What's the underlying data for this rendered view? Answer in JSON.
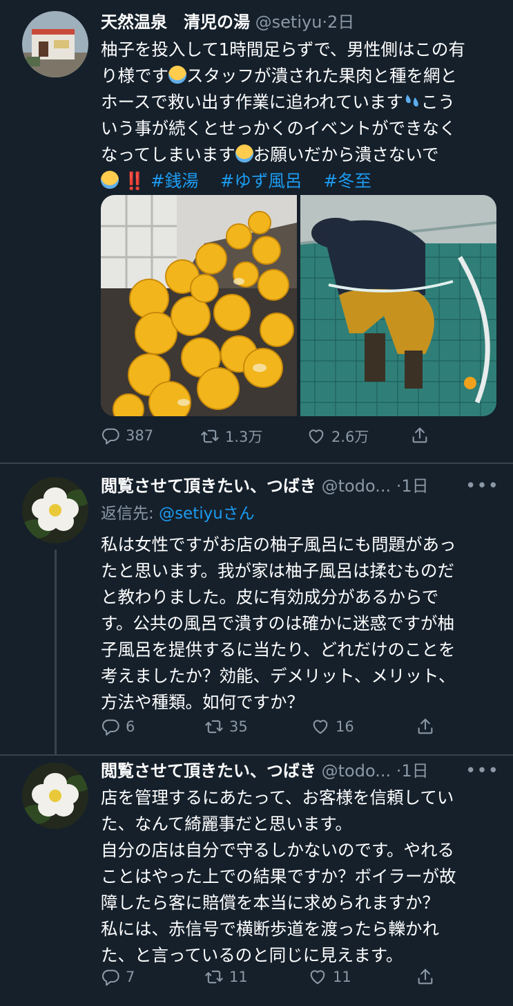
{
  "tweet1": {
    "name": "天然温泉　清児の湯",
    "handle": "@setiyu",
    "time": "·2日",
    "text_lines": [
      "柚子を投入して1時間足らずで、男性側はこの有",
      "り様です",
      "スタッフが潰された果肉と種を網と",
      "ホースで救い出す作業に追われています",
      "こう",
      "いう事が続くとせっかくのイベントができなく",
      "なってしまいます",
      "お願いだから潰さないで",
      "‼️"
    ],
    "hashtags": [
      "#銭湯",
      "#ゆず風呂",
      "#冬至"
    ],
    "replies": "387",
    "retweets": "1.3万",
    "likes": "2.6万"
  },
  "tweet2": {
    "name": "閲覧させて頂きたい、つばき",
    "handle": "@todo...",
    "time": "·1日",
    "more": "•••",
    "reply_prefix": "返信先: ",
    "reply_to": "@setiyuさん",
    "lines": [
      "私は女性ですがお店の柚子風呂にも問題があっ",
      "たと思います。我が家は柚子風呂は揉むものだ",
      "と教わりました。皮に有効成分があるからで",
      "す。公共の風呂で潰すのは確かに迷惑ですが柚",
      "子風呂を提供するに当たり、どれだけのことを",
      "考えましたか？効能、デメリット、メリット、",
      "方法や種類。如何ですか？"
    ],
    "replies": "6",
    "retweets": "35",
    "likes": "16"
  },
  "tweet3": {
    "name": "閲覧させて頂きたい、つばき",
    "handle": "@todo...",
    "time": "·1日",
    "more": "•••",
    "lines": [
      "店を管理するにあたって、お客様を信頼してい",
      "た、なんて綺麗事だと思います。",
      "自分の店は自分で守るしかないのです。やれる",
      "ことはやった上での結果ですか？ボイラーが故",
      "障したら客に賠償を本当に求められますか？",
      "私には、赤信号で横断歩道を渡ったら轢かれ",
      "た、と言っているのと同じに見えます。"
    ],
    "replies": "7",
    "retweets": "11",
    "likes": "11"
  },
  "colors": {
    "background": "#15202b",
    "link": "#1d9bf0",
    "muted": "#8b98a5",
    "divider": "#38444d"
  }
}
